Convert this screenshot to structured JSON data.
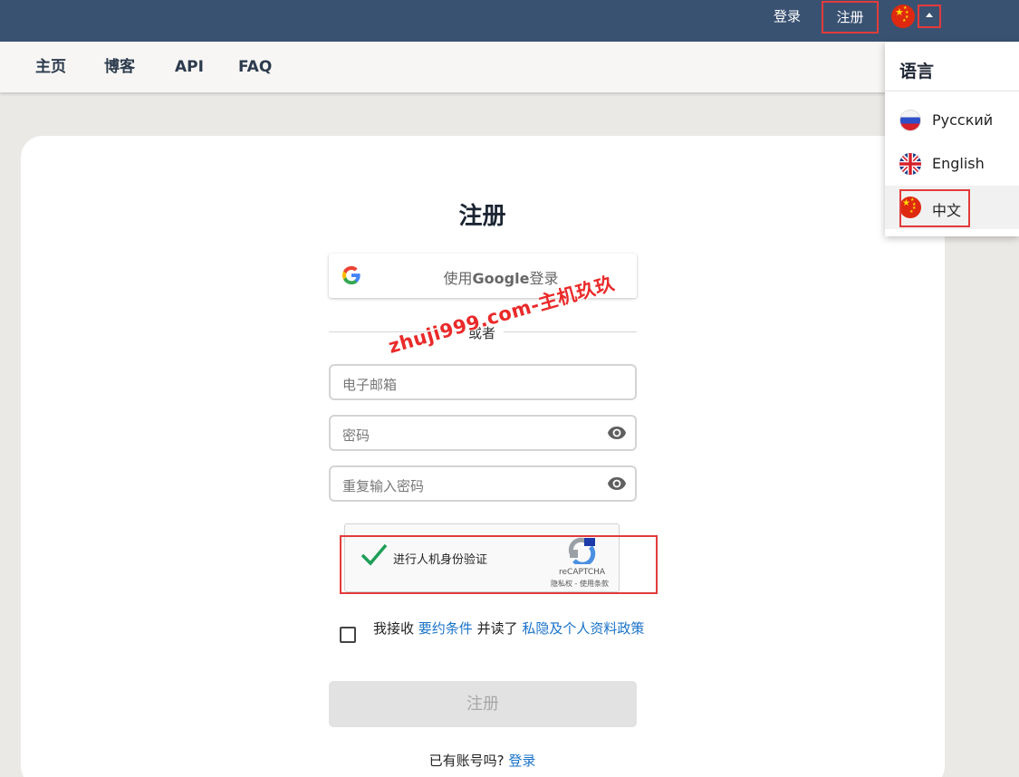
{
  "topbar": {
    "login": "登录",
    "register": "注册"
  },
  "nav": {
    "items": [
      "主页",
      "博客",
      "API",
      "FAQ"
    ]
  },
  "language_menu": {
    "title": "语言",
    "items": [
      {
        "label": "Русский",
        "icon": "flag-ru-icon"
      },
      {
        "label": "English",
        "icon": "flag-uk-icon"
      },
      {
        "label": "中文",
        "icon": "flag-cn-icon",
        "selected": true
      }
    ]
  },
  "form": {
    "title": "注册",
    "google_pre": "使用",
    "google_bold": "Google",
    "google_post": "登录",
    "or": "或者",
    "email_placeholder": "电子邮箱",
    "password_placeholder": "密码",
    "repeat_password_placeholder": "重复输入密码",
    "recaptcha_label": "进行人机身份验证",
    "recaptcha_brand": "reCAPTCHA",
    "recaptcha_terms": "隐私权 - 使用条款",
    "terms_pre": "我接收 ",
    "terms_link1": "要约条件",
    "terms_mid": " 并读了 ",
    "terms_link2": "私隐及个人资料政策",
    "submit": "注册",
    "have_account": "已有账号吗? ",
    "login_link": "登录"
  },
  "watermark": "zhuji999.com-主机玖玖",
  "colors": {
    "topbar": "#3a5272",
    "highlight": "#e23b3b",
    "link": "#1a73c9"
  }
}
